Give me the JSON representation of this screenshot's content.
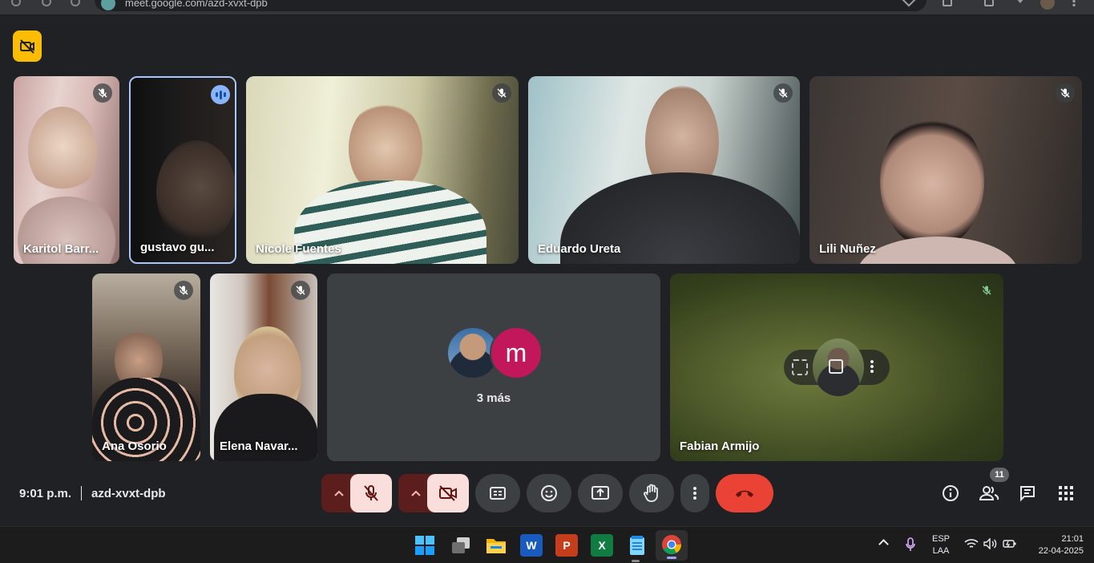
{
  "browser": {
    "url": "meet.google.com/azd-xvxt-dpb"
  },
  "participants": [
    {
      "name": "Karitol Barr...",
      "muted": true
    },
    {
      "name": "gustavo gu...",
      "muted": false,
      "speaking": true
    },
    {
      "name": "Nicole Fuentes",
      "muted": true
    },
    {
      "name": "Eduardo Ureta",
      "muted": true
    },
    {
      "name": "Lili Nuñez",
      "muted": true
    },
    {
      "name": "Ana Osorio",
      "muted": true
    },
    {
      "name": "Elena Navar...",
      "muted": true
    },
    {
      "name": "Fabian Armijo",
      "muted": true
    }
  ],
  "more_tile": {
    "avatar_letter": "m",
    "label": "3 más"
  },
  "meeting": {
    "time": "9:01 p.m.",
    "code": "azd-xvxt-dpb"
  },
  "people_count": "11",
  "taskbar": {
    "lang_primary": "ESP",
    "lang_secondary": "LAA",
    "clock_time": "21:01",
    "clock_date": "22-04-2025",
    "apps": [
      "start-icon",
      "task-view-icon",
      "file-explorer-icon",
      "word-icon",
      "powerpoint-icon",
      "excel-icon",
      "notepad-icon",
      "chrome-icon"
    ]
  },
  "colors": {
    "background": "#202124",
    "tile_more": "#3c4043",
    "end_call": "#ea4335",
    "muted_control_bg": "#f9dedc",
    "muted_control_dark": "#5c1d1d",
    "speaking_badge": "#8ab4f8",
    "recording_badge": "#fbbc04",
    "avatar_m": "#c2185b"
  }
}
